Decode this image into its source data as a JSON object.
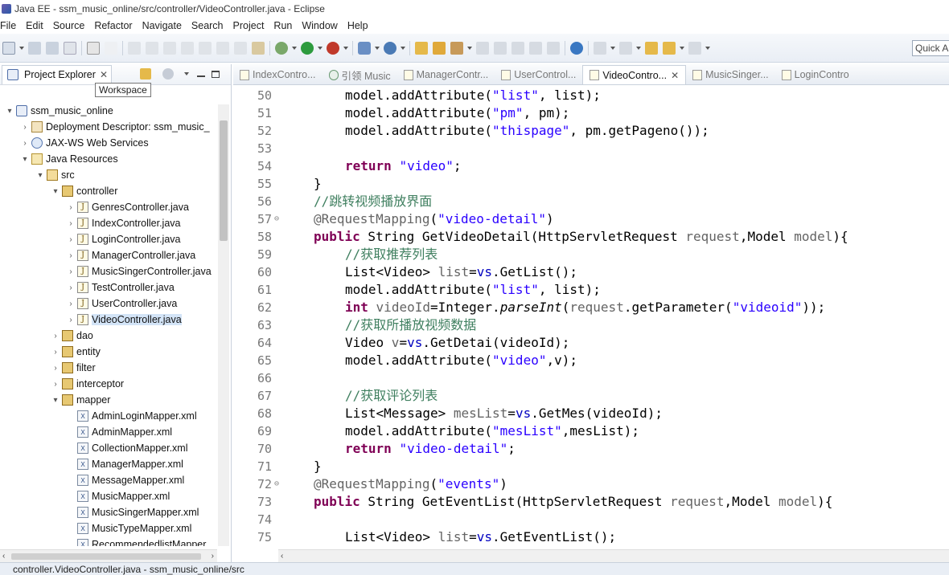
{
  "window": {
    "title": "Java EE - ssm_music_online/src/controller/VideoController.java - Eclipse"
  },
  "menu": [
    "File",
    "Edit",
    "Source",
    "Refactor",
    "Navigate",
    "Search",
    "Project",
    "Run",
    "Window",
    "Help"
  ],
  "toolbar": {
    "quick_access": "Quick A"
  },
  "project_explorer": {
    "tab_label": "Project Explorer",
    "tooltip": "Workspace",
    "tree": [
      {
        "label": "ssm_music_online",
        "depth": 0,
        "twisty": "▾",
        "icon": "project"
      },
      {
        "label": "Deployment Descriptor: ssm_music_",
        "depth": 1,
        "twisty": "›",
        "icon": "dd"
      },
      {
        "label": "JAX-WS Web Services",
        "depth": 1,
        "twisty": "›",
        "icon": "ws"
      },
      {
        "label": "Java Resources",
        "depth": 1,
        "twisty": "▾",
        "icon": "jr"
      },
      {
        "label": "src",
        "depth": 2,
        "twisty": "▾",
        "icon": "src"
      },
      {
        "label": "controller",
        "depth": 3,
        "twisty": "▾",
        "icon": "pkg"
      },
      {
        "label": "GenresController.java",
        "depth": 4,
        "twisty": "›",
        "icon": "java"
      },
      {
        "label": "IndexController.java",
        "depth": 4,
        "twisty": "›",
        "icon": "java"
      },
      {
        "label": "LoginController.java",
        "depth": 4,
        "twisty": "›",
        "icon": "java"
      },
      {
        "label": "ManagerController.java",
        "depth": 4,
        "twisty": "›",
        "icon": "java"
      },
      {
        "label": "MusicSingerController.java",
        "depth": 4,
        "twisty": "›",
        "icon": "java"
      },
      {
        "label": "TestController.java",
        "depth": 4,
        "twisty": "›",
        "icon": "java"
      },
      {
        "label": "UserController.java",
        "depth": 4,
        "twisty": "›",
        "icon": "java"
      },
      {
        "label": "VideoController.java",
        "depth": 4,
        "twisty": "›",
        "icon": "java",
        "selected": true
      },
      {
        "label": "dao",
        "depth": 3,
        "twisty": "›",
        "icon": "pkg"
      },
      {
        "label": "entity",
        "depth": 3,
        "twisty": "›",
        "icon": "pkg"
      },
      {
        "label": "filter",
        "depth": 3,
        "twisty": "›",
        "icon": "pkg"
      },
      {
        "label": "interceptor",
        "depth": 3,
        "twisty": "›",
        "icon": "pkg"
      },
      {
        "label": "mapper",
        "depth": 3,
        "twisty": "▾",
        "icon": "pkg"
      },
      {
        "label": "AdminLoginMapper.xml",
        "depth": 4,
        "twisty": "",
        "icon": "xml"
      },
      {
        "label": "AdminMapper.xml",
        "depth": 4,
        "twisty": "",
        "icon": "xml"
      },
      {
        "label": "CollectionMapper.xml",
        "depth": 4,
        "twisty": "",
        "icon": "xml"
      },
      {
        "label": "ManagerMapper.xml",
        "depth": 4,
        "twisty": "",
        "icon": "xml"
      },
      {
        "label": "MessageMapper.xml",
        "depth": 4,
        "twisty": "",
        "icon": "xml"
      },
      {
        "label": "MusicMapper.xml",
        "depth": 4,
        "twisty": "",
        "icon": "xml"
      },
      {
        "label": "MusicSingerMapper.xml",
        "depth": 4,
        "twisty": "",
        "icon": "xml"
      },
      {
        "label": "MusicTypeMapper.xml",
        "depth": 4,
        "twisty": "",
        "icon": "xml"
      },
      {
        "label": "RecommendedlistMapper",
        "depth": 4,
        "twisty": "",
        "icon": "xml"
      }
    ]
  },
  "editor": {
    "tabs": [
      {
        "label": "IndexContro...",
        "active": false,
        "icon": "file"
      },
      {
        "label": "引领 Music",
        "active": false,
        "icon": "globe"
      },
      {
        "label": "ManagerContr...",
        "active": false,
        "icon": "file"
      },
      {
        "label": "UserControl...",
        "active": false,
        "icon": "file"
      },
      {
        "label": "VideoContro...",
        "active": true,
        "icon": "file"
      },
      {
        "label": "MusicSinger...",
        "active": false,
        "icon": "file"
      },
      {
        "label": "LoginContro",
        "active": false,
        "icon": "file"
      }
    ],
    "lines": [
      {
        "n": "50",
        "fold": false,
        "indent": 2,
        "parts": [
          [
            "t",
            "model.addAttribute("
          ],
          [
            "s",
            "\"list\""
          ],
          [
            "t",
            ", list);"
          ]
        ]
      },
      {
        "n": "51",
        "fold": false,
        "indent": 2,
        "parts": [
          [
            "t",
            "model.addAttribute("
          ],
          [
            "s",
            "\"pm\""
          ],
          [
            "t",
            ", pm);"
          ]
        ]
      },
      {
        "n": "52",
        "fold": false,
        "indent": 2,
        "parts": [
          [
            "t",
            "model.addAttribute("
          ],
          [
            "s",
            "\"thispage\""
          ],
          [
            "t",
            ", pm.getPageno());"
          ]
        ]
      },
      {
        "n": "53",
        "fold": false,
        "indent": 0,
        "parts": []
      },
      {
        "n": "54",
        "fold": false,
        "indent": 2,
        "parts": [
          [
            "k",
            "return"
          ],
          [
            "t",
            " "
          ],
          [
            "s",
            "\"video\""
          ],
          [
            "t",
            ";"
          ]
        ]
      },
      {
        "n": "55",
        "fold": false,
        "indent": 1,
        "parts": [
          [
            "t",
            "}"
          ]
        ]
      },
      {
        "n": "56",
        "fold": false,
        "indent": 1,
        "parts": [
          [
            "c",
            "//跳转视频播放界面"
          ]
        ]
      },
      {
        "n": "57",
        "fold": true,
        "indent": 1,
        "parts": [
          [
            "a",
            "@RequestMapping"
          ],
          [
            "t",
            "("
          ],
          [
            "s",
            "\"video-detail\""
          ],
          [
            "t",
            ")"
          ]
        ]
      },
      {
        "n": "58",
        "fold": false,
        "indent": 1,
        "parts": [
          [
            "k",
            "public"
          ],
          [
            "t",
            " String GetVideoDetail(HttpServletRequest "
          ],
          [
            "a",
            "request"
          ],
          [
            "t",
            ",Model "
          ],
          [
            "a",
            "model"
          ],
          [
            "t",
            "){"
          ]
        ]
      },
      {
        "n": "59",
        "fold": false,
        "indent": 2,
        "parts": [
          [
            "c",
            "//获取推荐列表"
          ]
        ]
      },
      {
        "n": "60",
        "fold": false,
        "indent": 2,
        "parts": [
          [
            "t",
            "List<Video> "
          ],
          [
            "a",
            "list"
          ],
          [
            "t",
            "="
          ],
          [
            "f",
            "vs"
          ],
          [
            "t",
            ".GetList();"
          ]
        ]
      },
      {
        "n": "61",
        "fold": false,
        "indent": 2,
        "parts": [
          [
            "t",
            "model.addAttribute("
          ],
          [
            "s",
            "\"list\""
          ],
          [
            "t",
            ", list);"
          ]
        ]
      },
      {
        "n": "62",
        "fold": false,
        "indent": 2,
        "parts": [
          [
            "k",
            "int"
          ],
          [
            "t",
            " "
          ],
          [
            "a",
            "videoId"
          ],
          [
            "t",
            "=Integer."
          ],
          [
            "i",
            "parseInt"
          ],
          [
            "t",
            "("
          ],
          [
            "a",
            "request"
          ],
          [
            "t",
            ".getParameter("
          ],
          [
            "s",
            "\"videoid\""
          ],
          [
            "t",
            "));"
          ]
        ]
      },
      {
        "n": "63",
        "fold": false,
        "indent": 2,
        "parts": [
          [
            "c",
            "//获取所播放视频数据"
          ]
        ]
      },
      {
        "n": "64",
        "fold": false,
        "indent": 2,
        "parts": [
          [
            "t",
            "Video "
          ],
          [
            "a",
            "v"
          ],
          [
            "t",
            "="
          ],
          [
            "f",
            "vs"
          ],
          [
            "t",
            ".GetDetai(videoId);"
          ]
        ]
      },
      {
        "n": "65",
        "fold": false,
        "indent": 2,
        "parts": [
          [
            "t",
            "model.addAttribute("
          ],
          [
            "s",
            "\"video\""
          ],
          [
            "t",
            ",v);"
          ]
        ]
      },
      {
        "n": "66",
        "fold": false,
        "indent": 0,
        "parts": []
      },
      {
        "n": "67",
        "fold": false,
        "indent": 2,
        "parts": [
          [
            "c",
            "//获取评论列表"
          ]
        ]
      },
      {
        "n": "68",
        "fold": false,
        "indent": 2,
        "parts": [
          [
            "t",
            "List<Message> "
          ],
          [
            "a",
            "mesList"
          ],
          [
            "t",
            "="
          ],
          [
            "f",
            "vs"
          ],
          [
            "t",
            ".GetMes(videoId);"
          ]
        ]
      },
      {
        "n": "69",
        "fold": false,
        "indent": 2,
        "parts": [
          [
            "t",
            "model.addAttribute("
          ],
          [
            "s",
            "\"mesList\""
          ],
          [
            "t",
            ",mesList);"
          ]
        ]
      },
      {
        "n": "70",
        "fold": false,
        "indent": 2,
        "parts": [
          [
            "k",
            "return"
          ],
          [
            "t",
            " "
          ],
          [
            "s",
            "\"video-detail\""
          ],
          [
            "t",
            ";"
          ]
        ]
      },
      {
        "n": "71",
        "fold": false,
        "indent": 1,
        "parts": [
          [
            "t",
            "}"
          ]
        ]
      },
      {
        "n": "72",
        "fold": true,
        "indent": 1,
        "parts": [
          [
            "a",
            "@RequestMapping"
          ],
          [
            "t",
            "("
          ],
          [
            "s",
            "\"events\""
          ],
          [
            "t",
            ")"
          ]
        ]
      },
      {
        "n": "73",
        "fold": false,
        "indent": 1,
        "parts": [
          [
            "k",
            "public"
          ],
          [
            "t",
            " String GetEventList(HttpServletRequest "
          ],
          [
            "a",
            "request"
          ],
          [
            "t",
            ",Model "
          ],
          [
            "a",
            "model"
          ],
          [
            "t",
            "){"
          ]
        ]
      },
      {
        "n": "74",
        "fold": false,
        "indent": 0,
        "parts": []
      },
      {
        "n": "75",
        "fold": false,
        "indent": 2,
        "parts": [
          [
            "t",
            "List<Video> "
          ],
          [
            "a",
            "list"
          ],
          [
            "t",
            "="
          ],
          [
            "f",
            "vs"
          ],
          [
            "t",
            ".GetEventList();"
          ]
        ]
      }
    ]
  },
  "status": {
    "text": "controller.VideoController.java - ssm_music_online/src"
  },
  "colors": {
    "keyword": "#7f0055",
    "string": "#2a00ff",
    "comment": "#3f7f5f",
    "field": "#0000c0",
    "selection": "#d3e4f7"
  }
}
